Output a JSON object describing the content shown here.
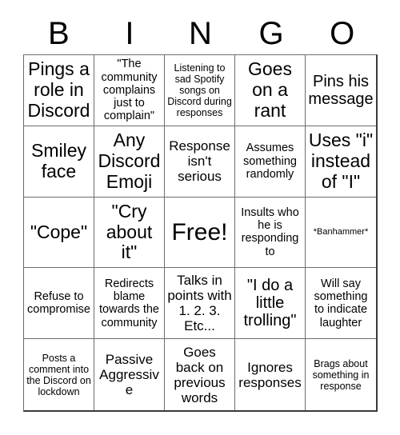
{
  "card": {
    "header_letters": [
      "B",
      "I",
      "N",
      "G",
      "O"
    ],
    "columns": 5,
    "rows": 5,
    "free_space_index": 12,
    "colors": {
      "background": "#ffffff",
      "text": "#000000",
      "grid_line": "#6d6d6d",
      "outer_border": "#3a3a3a"
    },
    "cells": [
      {
        "text": "Pings a role in Discord",
        "size": "xl"
      },
      {
        "text": "\"The community complains just to complain\"",
        "size": "sm"
      },
      {
        "text": "Listening to sad Spotify songs on Discord during responses",
        "size": "xs"
      },
      {
        "text": "Goes on a rant",
        "size": "xl"
      },
      {
        "text": "Pins his message",
        "size": "lg"
      },
      {
        "text": "Smiley face",
        "size": "xl"
      },
      {
        "text": "Any Discord Emoji",
        "size": "xl"
      },
      {
        "text": "Response isn't serious",
        "size": "md"
      },
      {
        "text": "Assumes something randomly",
        "size": "sm"
      },
      {
        "text": "Uses \"i\" instead of \"I\"",
        "size": "xl"
      },
      {
        "text": "\"Cope\"",
        "size": "xl"
      },
      {
        "text": "\"Cry about it\"",
        "size": "xl"
      },
      {
        "text": "Free!",
        "size": "xxl"
      },
      {
        "text": "Insults who he is responding to",
        "size": "sm"
      },
      {
        "text": "*Banhammer*",
        "size": "xxs"
      },
      {
        "text": "Refuse to compromise",
        "size": "sm"
      },
      {
        "text": "Redirects blame towards the community",
        "size": "sm"
      },
      {
        "text": "Talks in points with 1. 2. 3. Etc...",
        "size": "md"
      },
      {
        "text": "\"I do a little trolling\"",
        "size": "lg"
      },
      {
        "text": "Will say something to indicate laughter",
        "size": "sm"
      },
      {
        "text": "Posts a comment into the Discord on lockdown",
        "size": "xs"
      },
      {
        "text": "Passive Aggressive",
        "size": "md"
      },
      {
        "text": "Goes back on previous words",
        "size": "md"
      },
      {
        "text": "Ignores responses",
        "size": "md"
      },
      {
        "text": "Brags about something in response",
        "size": "xs"
      }
    ]
  }
}
